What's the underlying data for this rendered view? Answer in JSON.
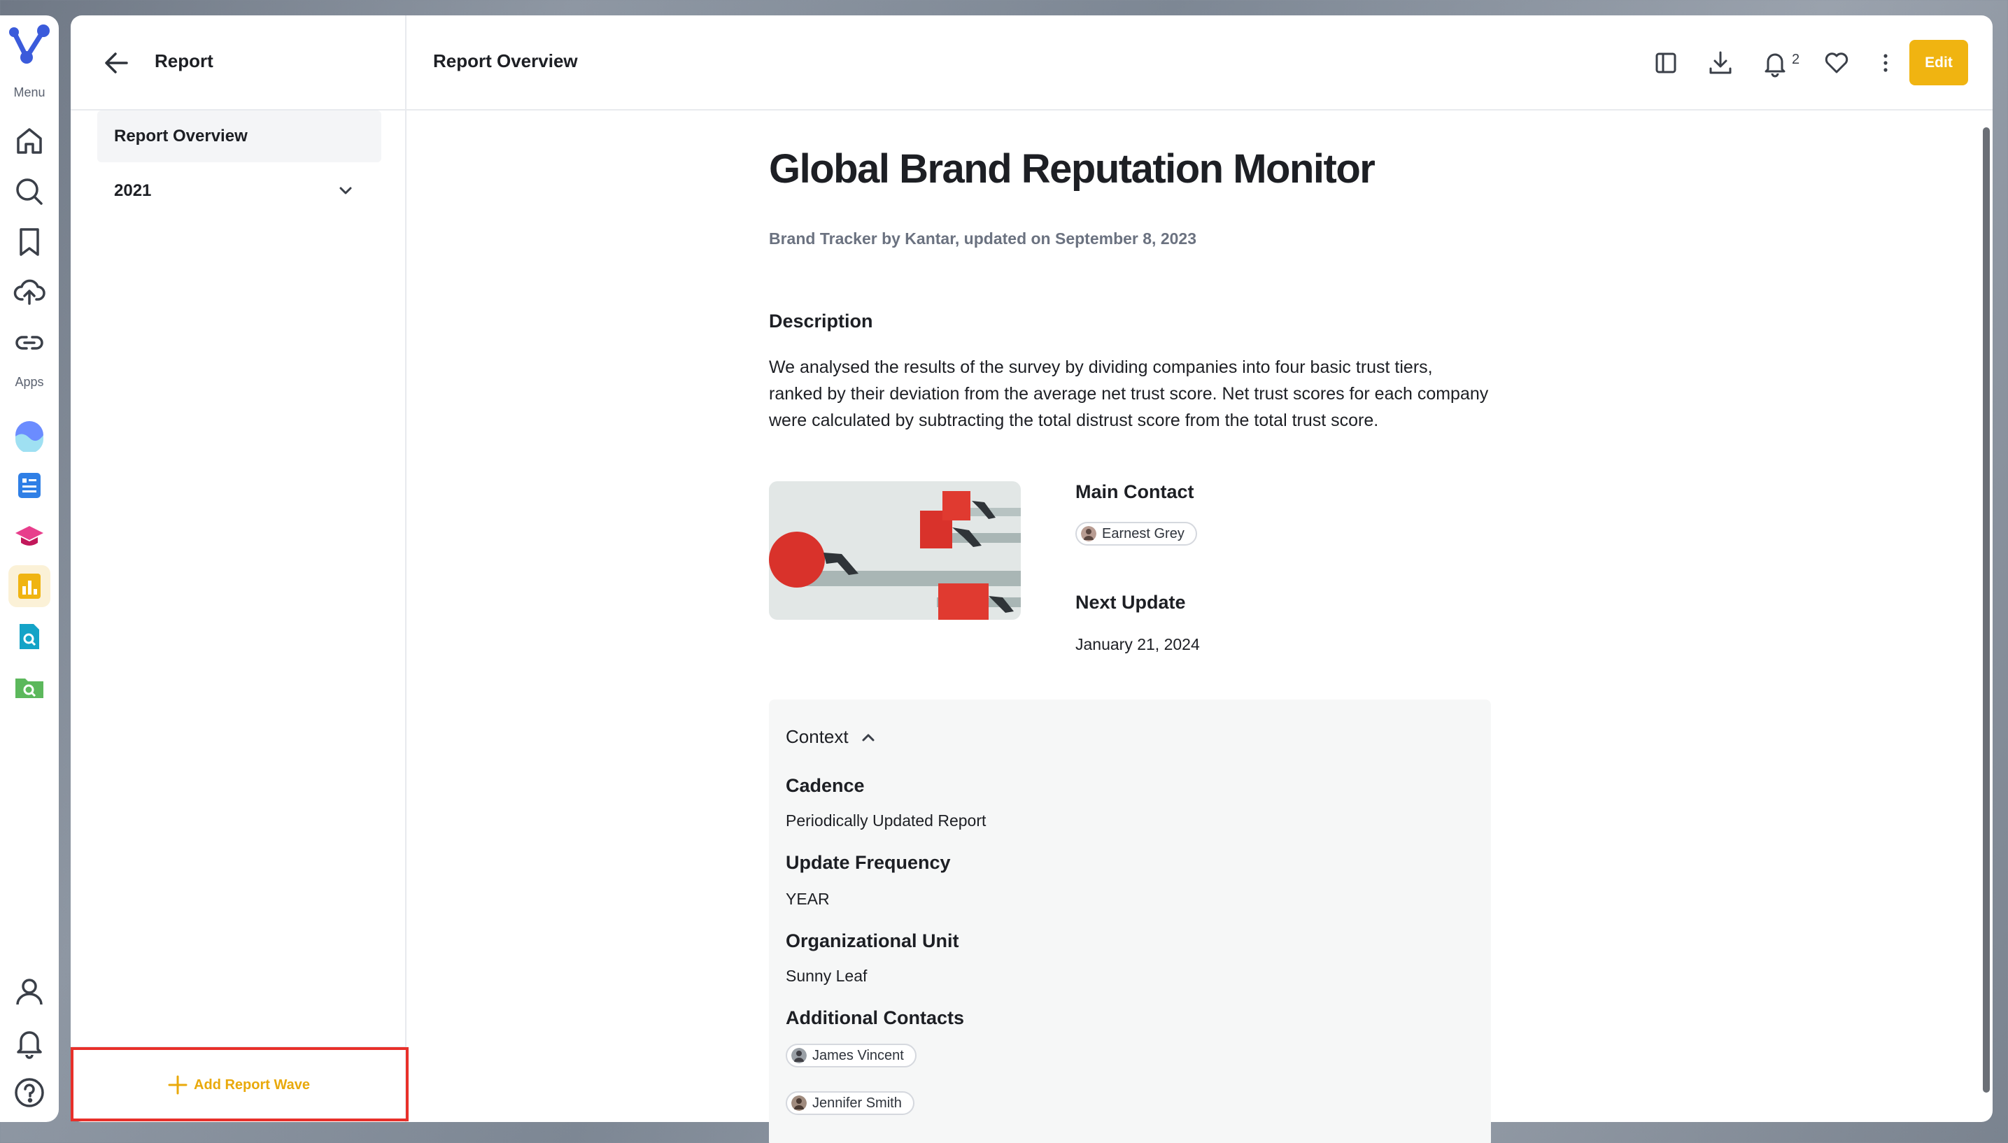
{
  "rail": {
    "menu_label": "Menu",
    "apps_label": "Apps",
    "menu_items": [
      "home-icon",
      "search-icon",
      "bookmark-icon",
      "upload-cloud-icon",
      "link-icon"
    ],
    "apps": [
      "wave-app-icon",
      "document-app-icon",
      "learning-app-icon",
      "charts-app-icon",
      "file-search-app-icon",
      "folder-search-app-icon"
    ],
    "bottom_items": [
      "user-icon",
      "bell-icon",
      "help-icon"
    ],
    "accent": "#f0b411"
  },
  "left_panel": {
    "title": "Report",
    "nav": {
      "overview_label": "Report Overview",
      "year_label": "2021"
    },
    "add_wave_label": "Add Report Wave"
  },
  "topbar": {
    "title": "Report Overview",
    "notification_count": "2",
    "edit_label": "Edit"
  },
  "report": {
    "title": "Global Brand Reputation Monitor",
    "subtitle": "Brand Tracker by Kantar, updated on September 8, 2023",
    "description_heading": "Description",
    "description": "We analysed the results of the survey by dividing companies into four basic trust tiers, ranked by their deviation from the average net trust score. Net trust scores for each company were calculated by subtracting the total distrust score from the total trust score.",
    "main_contact_label": "Main Contact",
    "main_contact": "Earnest Grey",
    "next_update_label": "Next Update",
    "next_update": "January 21, 2024"
  },
  "context": {
    "heading": "Context",
    "cadence_label": "Cadence",
    "cadence": "Periodically Updated Report",
    "frequency_label": "Update Frequency",
    "frequency": "YEAR",
    "org_unit_label": "Organizational Unit",
    "org_unit": "Sunny Leaf",
    "additional_contacts_label": "Additional Contacts",
    "contact_1": "James Vincent",
    "contact_2": "Jennifer Smith"
  }
}
